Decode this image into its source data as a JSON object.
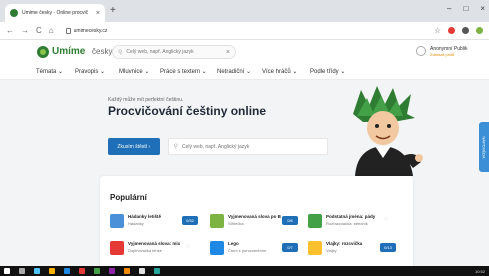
{
  "browser": {
    "tab_title": "Umime česky - Online procvič",
    "tab_close": "×",
    "new_tab": "+",
    "window_controls": [
      "–",
      "□",
      "×"
    ],
    "nav_back": "←",
    "nav_forward": "→",
    "nav_reload": "C",
    "nav_home": "⌂",
    "url": "umimecesky.cz",
    "star": "☆"
  },
  "site": {
    "logo_text": "Umíme",
    "logo_lang": "česky ⌄",
    "search_placeholder": "Celý web, např. Anglický jazyk",
    "search_clear": "×",
    "user_name": "Anonymní Publik",
    "user_action": "Zobrazit profil"
  },
  "menu": [
    {
      "label": "Témata ⌄"
    },
    {
      "label": "Pravopis ⌄"
    },
    {
      "label": "Mluvnice ⌄"
    },
    {
      "label": "Práce s textem ⌄"
    },
    {
      "label": "Netradiční ⌄"
    },
    {
      "label": "Více hráčů ⌄"
    },
    {
      "label": "Podle třídy ⌄"
    }
  ],
  "hero": {
    "kicker": "Každý může mít perfektní češtinu.",
    "title": "Procvičování češtiny online",
    "cta": "Zkusím štěstí ›",
    "input_placeholder": "Celý web, např. Anglický jazyk"
  },
  "side_tab": "NÁPOVĚDA",
  "popular": {
    "title": "Populární",
    "tiles": [
      {
        "name": "Hádanky letiště",
        "sub": "Hádanky",
        "badge": "0/32",
        "icon_color": "#4a90d9"
      },
      {
        "name": "Vyjmenovaná slova po B",
        "sub": "Střílečka",
        "badge": "0/6",
        "icon_color": "#7cb342"
      },
      {
        "name": "Podstatná jména: pády",
        "sub": "Rozřazovačka: středník",
        "badge": "",
        "icon_color": "#43a047"
      },
      {
        "name": "Vyjmenovaná slova: mix",
        "sub": "Doplňovačka lehké",
        "badge": "",
        "icon_color": "#e53935"
      },
      {
        "name": "Lego",
        "sub": "Čtení s porozuměním",
        "badge": "0/7",
        "icon_color": "#1e88e5"
      },
      {
        "name": "Vlajky: rozcvička",
        "sub": "Vlajky",
        "badge": "0/13",
        "icon_color": "#fbc02d"
      }
    ]
  },
  "taskbar": {
    "time": "10:52",
    "icon_colors": [
      "#ffffff",
      "#aaaaaa",
      "#4fc3f7",
      "#ffb300",
      "#1e88e5",
      "#e53935",
      "#43a047",
      "#8e24aa",
      "#fb8c00",
      "#e0e0e0",
      "#26a69a"
    ]
  },
  "colors": {
    "brand_green": "#2e7d32",
    "accent_blue": "#1e6fb8",
    "background": "#f3f4f6"
  }
}
